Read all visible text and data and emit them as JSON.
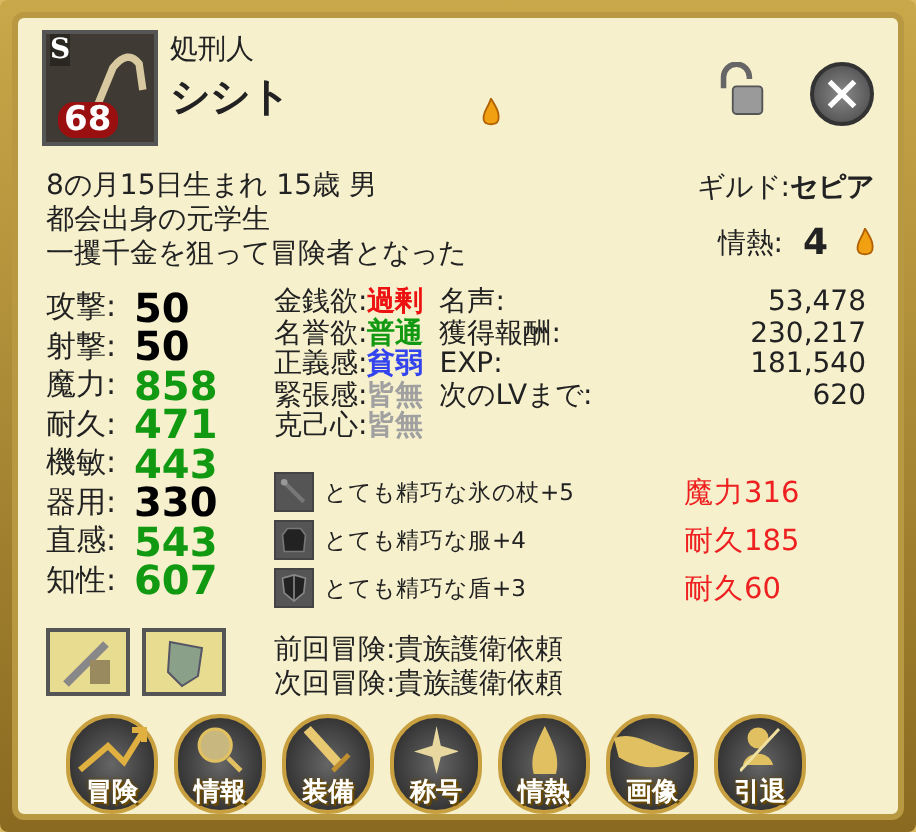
{
  "portrait": {
    "rank": "S",
    "level": "68"
  },
  "character": {
    "class": "処刑人",
    "name": "シシト"
  },
  "bio": [
    "8の月15日生まれ 15歳 男",
    "都会出身の元学生",
    "一攫千金を狙って冒険者となった"
  ],
  "guild": {
    "label": "ギルド:",
    "value": "セピア"
  },
  "passion": {
    "label": "情熱:",
    "value": "4"
  },
  "stats": [
    {
      "label": "攻撃:",
      "value": "50",
      "color": "#000000"
    },
    {
      "label": "射撃:",
      "value": "50",
      "color": "#000000"
    },
    {
      "label": "魔力:",
      "value": "858",
      "color": "#119911"
    },
    {
      "label": "耐久:",
      "value": "471",
      "color": "#119911"
    },
    {
      "label": "機敏:",
      "value": "443",
      "color": "#119911"
    },
    {
      "label": "器用:",
      "value": "330",
      "color": "#000000"
    },
    {
      "label": "直感:",
      "value": "543",
      "color": "#119911"
    },
    {
      "label": "知性:",
      "value": "607",
      "color": "#119911"
    }
  ],
  "traits": [
    {
      "label": "金銭欲:",
      "value": "過剰",
      "color": "#ee1111"
    },
    {
      "label": "名誉欲:",
      "value": "普通",
      "color": "#119911"
    },
    {
      "label": "正義感:",
      "value": "貧弱",
      "color": "#3344ee"
    },
    {
      "label": "緊張感:",
      "value": "皆無",
      "color": "#a0a0a0"
    },
    {
      "label": "克己心:",
      "value": "皆無",
      "color": "#a0a0a0"
    }
  ],
  "records": [
    {
      "label": "名声:",
      "value": "53,478"
    },
    {
      "label": "獲得報酬:",
      "value": "230,217"
    },
    {
      "label": "EXP:",
      "value": "181,540"
    },
    {
      "label": "次のLVまで:",
      "value": "620"
    }
  ],
  "equipment": [
    {
      "kind": "staff",
      "name": "とても精巧な氷の杖+5",
      "bonus": "魔力316"
    },
    {
      "kind": "clothes",
      "name": "とても精巧な服+4",
      "bonus": "耐久185"
    },
    {
      "kind": "shield",
      "name": "とても精巧な盾+3",
      "bonus": "耐久60"
    }
  ],
  "quests": [
    {
      "label": "前回冒険:",
      "value": "貴族護衛依頼"
    },
    {
      "label": "次回冒険:",
      "value": "貴族護衛依頼"
    }
  ],
  "menu": [
    {
      "kind": "arrow",
      "label": "冒険"
    },
    {
      "kind": "lens",
      "label": "情報"
    },
    {
      "kind": "sword",
      "label": "装備"
    },
    {
      "kind": "star",
      "label": "称号"
    },
    {
      "kind": "flame",
      "label": "情熱"
    },
    {
      "kind": "bird",
      "label": "画像"
    },
    {
      "kind": "figure",
      "label": "引退"
    }
  ]
}
